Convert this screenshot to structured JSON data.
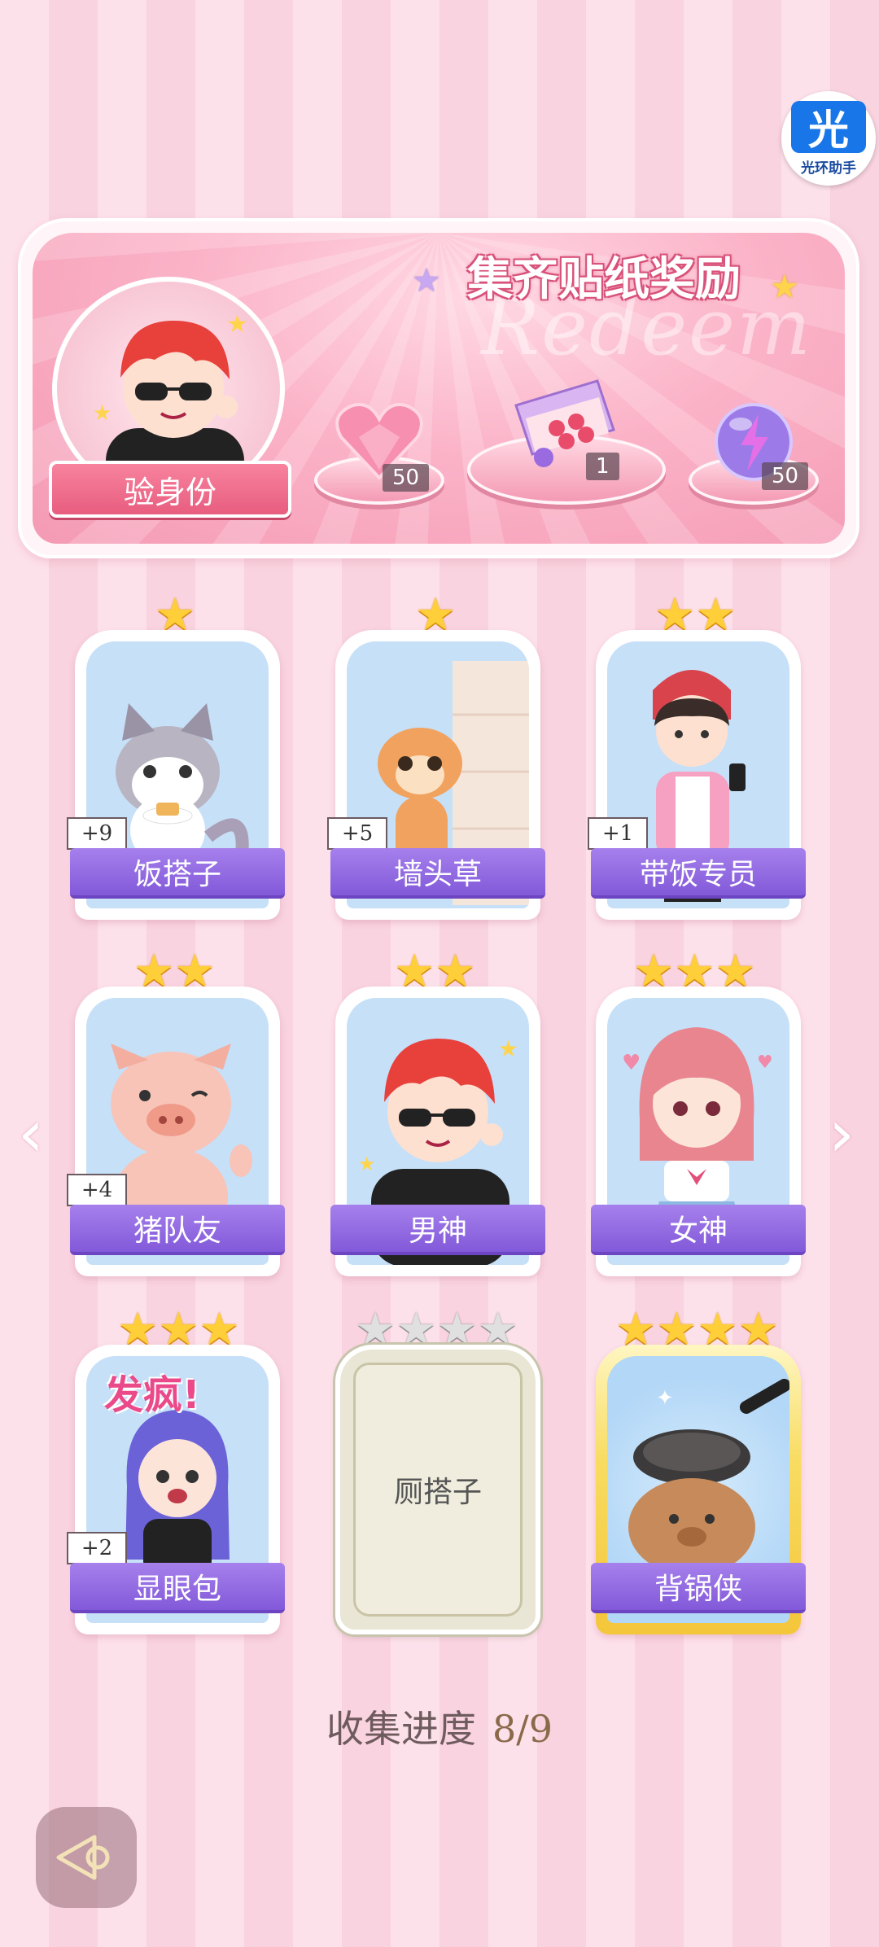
{
  "helper_badge": {
    "glyph": "光",
    "caption": "光环助手"
  },
  "banner": {
    "title": "集齐贴纸奖励",
    "watermark": "Redeem",
    "verify_button": "验身份",
    "rewards": [
      {
        "icon": "heart-gem-icon",
        "count": "50"
      },
      {
        "icon": "gift-box-icon",
        "count": "1"
      },
      {
        "icon": "lightning-orb-icon",
        "count": "50"
      }
    ]
  },
  "cards": [
    {
      "name": "饭搭子",
      "stars": 1,
      "plus": "+9",
      "icon": "cat-sticker",
      "state": "owned"
    },
    {
      "name": "墙头草",
      "stars": 1,
      "plus": "+5",
      "icon": "weasel-sticker",
      "state": "owned"
    },
    {
      "name": "带饭专员",
      "stars": 2,
      "plus": "+1",
      "icon": "girl-phone-sticker",
      "state": "owned"
    },
    {
      "name": "猪队友",
      "stars": 2,
      "plus": "+4",
      "icon": "pig-sticker",
      "state": "owned"
    },
    {
      "name": "男神",
      "stars": 2,
      "plus": "",
      "icon": "boy-sunglasses-sticker",
      "state": "owned"
    },
    {
      "name": "女神",
      "stars": 3,
      "plus": "",
      "icon": "girl-pink-hair-sticker",
      "state": "owned"
    },
    {
      "name": "显眼包",
      "stars": 3,
      "plus": "+2",
      "icon": "crazy-girl-sticker",
      "state": "owned",
      "sticker_text": "发疯!"
    },
    {
      "name": "厕搭子",
      "stars": 4,
      "plus": "",
      "icon": "locked-sticker",
      "state": "locked"
    },
    {
      "name": "背锅侠",
      "stars": 4,
      "plus": "",
      "icon": "capybara-pan-sticker",
      "state": "owned-gold"
    }
  ],
  "progress": {
    "label": "收集进度",
    "value": "8/9"
  },
  "colors": {
    "name_bar": "#8b62de",
    "accent_pink": "#f49ab4",
    "star_gold": "#ffcf3a"
  }
}
